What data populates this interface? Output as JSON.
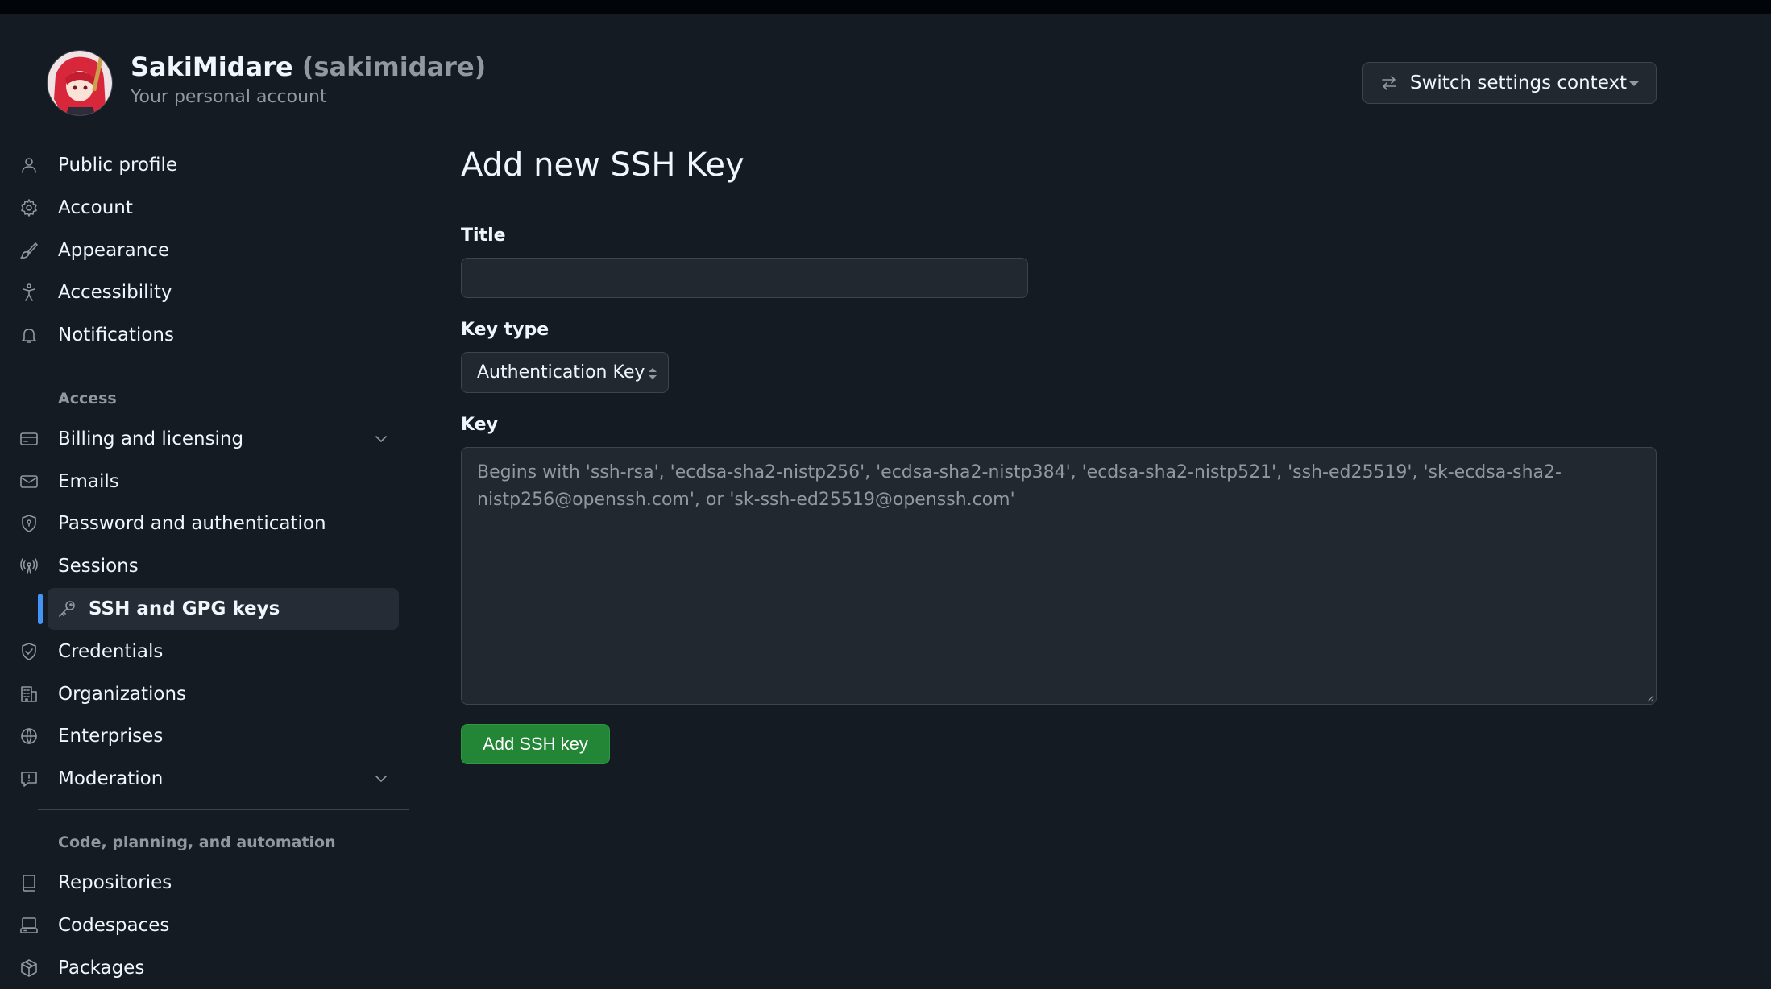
{
  "header": {
    "display_name": "SakiMidare",
    "login": "(sakimidare)",
    "subtitle": "Your personal account",
    "switch_label": "Switch settings context"
  },
  "sidebar": {
    "items_top": [
      {
        "label": "Public profile",
        "icon": "person-icon"
      },
      {
        "label": "Account",
        "icon": "gear-icon"
      },
      {
        "label": "Appearance",
        "icon": "paintbrush-icon"
      },
      {
        "label": "Accessibility",
        "icon": "accessibility-icon"
      },
      {
        "label": "Notifications",
        "icon": "bell-icon"
      }
    ],
    "section_access": "Access",
    "items_access": [
      {
        "label": "Billing and licensing",
        "icon": "credit-card-icon",
        "expandable": true
      },
      {
        "label": "Emails",
        "icon": "mail-icon"
      },
      {
        "label": "Password and authentication",
        "icon": "shield-lock-icon"
      },
      {
        "label": "Sessions",
        "icon": "broadcast-icon"
      },
      {
        "label": "SSH and GPG keys",
        "icon": "key-icon",
        "active": true
      },
      {
        "label": "Credentials",
        "icon": "shield-check-icon"
      },
      {
        "label": "Organizations",
        "icon": "organization-icon"
      },
      {
        "label": "Enterprises",
        "icon": "globe-icon"
      },
      {
        "label": "Moderation",
        "icon": "report-icon",
        "expandable": true
      }
    ],
    "section_code": "Code, planning, and automation",
    "items_code": [
      {
        "label": "Repositories",
        "icon": "repo-icon"
      },
      {
        "label": "Codespaces",
        "icon": "codespaces-icon"
      },
      {
        "label": "Packages",
        "icon": "package-icon"
      }
    ]
  },
  "main": {
    "page_title": "Add new SSH Key",
    "title_label": "Title",
    "title_value": "",
    "key_type_label": "Key type",
    "key_type_selected": "Authentication Key",
    "key_label": "Key",
    "key_placeholder": "Begins with 'ssh-rsa', 'ecdsa-sha2-nistp256', 'ecdsa-sha2-nistp384', 'ecdsa-sha2-nistp521', 'ssh-ed25519', 'sk-ecdsa-sha2-nistp256@openssh.com', or 'sk-ssh-ed25519@openssh.com'",
    "submit_label": "Add SSH key"
  },
  "colors": {
    "accent_blue": "#4493f8",
    "primary_green": "#238636",
    "background": "#151b23"
  }
}
